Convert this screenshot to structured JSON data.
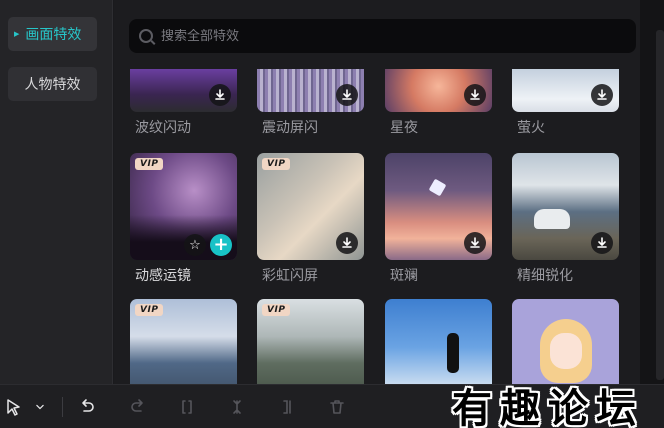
{
  "sidebar": {
    "items": [
      {
        "label": "画面特效",
        "active": true
      },
      {
        "label": "人物特效",
        "active": false
      }
    ]
  },
  "search": {
    "placeholder": "搜索全部特效",
    "value": ""
  },
  "effects": {
    "row1": [
      {
        "label": "波纹闪动",
        "download": true
      },
      {
        "label": "震动屏闪",
        "download": true
      },
      {
        "label": "星夜",
        "download": true
      },
      {
        "label": "萤火",
        "download": true
      }
    ],
    "row2": [
      {
        "label": "动感运镜",
        "vip": true,
        "favorite": true,
        "add": true
      },
      {
        "label": "彩虹闪屏",
        "vip": true,
        "download": true
      },
      {
        "label": "斑斓",
        "download": true
      },
      {
        "label": "精细锐化",
        "download": true
      }
    ],
    "row3": [
      {
        "vip": true
      },
      {
        "vip": true
      },
      {},
      {}
    ],
    "vip_badge": "VIP"
  },
  "toolbar": {
    "tools": [
      "select-cursor",
      "dropdown-chevron",
      "undo",
      "redo",
      "split",
      "split-left",
      "split-right",
      "delete"
    ]
  },
  "watermark": {
    "text": "有趣论坛"
  },
  "colors": {
    "accent": "#27c6c9",
    "add_button": "#18c2c7",
    "background": "#1a1a1d",
    "vip_badge": "#f1d6c4"
  }
}
